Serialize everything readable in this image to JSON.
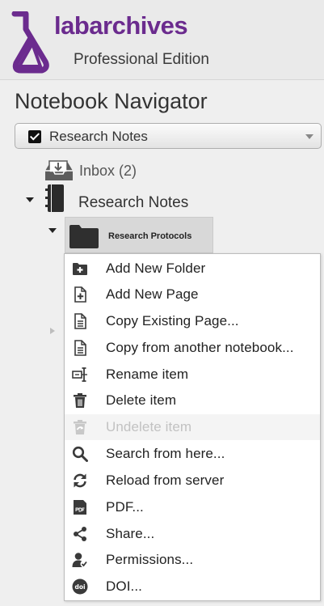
{
  "header": {
    "brand_name": "labarchives",
    "edition": "Professional Edition",
    "brand_color": "#6b2b8e"
  },
  "navigator": {
    "title": "Notebook Navigator",
    "notebook_select": {
      "selected": "Research Notes"
    }
  },
  "tree": {
    "inbox": {
      "label": "Inbox (2)",
      "icon": "inbox-icon"
    },
    "research_notes": {
      "label": "Research Notes",
      "icon": "notebook-icon",
      "expanded": true
    },
    "research_protocols": {
      "label": "Research Protocols",
      "icon": "folder-icon",
      "expanded": true,
      "selected": true
    }
  },
  "context_menu": {
    "items": [
      {
        "label": "Add New Folder",
        "icon": "add-folder-icon",
        "enabled": true
      },
      {
        "label": "Add New Page",
        "icon": "add-page-icon",
        "enabled": true
      },
      {
        "label": "Copy Existing Page...",
        "icon": "copy-page-icon",
        "enabled": true
      },
      {
        "label": "Copy from another notebook...",
        "icon": "copy-notebook-icon",
        "enabled": true
      },
      {
        "label": "Rename item",
        "icon": "rename-icon",
        "enabled": true
      },
      {
        "label": "Delete item",
        "icon": "trash-icon",
        "enabled": true
      },
      {
        "label": "Undelete item",
        "icon": "undelete-icon",
        "enabled": false
      },
      {
        "label": "Search from here...",
        "icon": "search-icon",
        "enabled": true
      },
      {
        "label": "Reload from server",
        "icon": "reload-icon",
        "enabled": true
      },
      {
        "label": "PDF...",
        "icon": "pdf-icon",
        "enabled": true
      },
      {
        "label": "Share...",
        "icon": "share-icon",
        "enabled": true
      },
      {
        "label": "Permissions...",
        "icon": "permissions-icon",
        "enabled": true
      },
      {
        "label": "DOI...",
        "icon": "doi-icon",
        "enabled": true
      }
    ]
  }
}
